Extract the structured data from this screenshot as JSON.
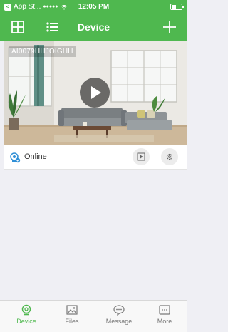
{
  "status_bar": {
    "carrier": "App St...",
    "signal": "●●●●●",
    "time": "12:05 PM",
    "back_glyph": "<"
  },
  "navbar": {
    "title": "Device"
  },
  "device": {
    "name": "AI0079HHJOIGHH",
    "status": "Online"
  },
  "tabs": [
    {
      "label": "Device",
      "icon": "webcam-icon",
      "active": true
    },
    {
      "label": "Files",
      "icon": "image-icon",
      "active": false
    },
    {
      "label": "Message",
      "icon": "chat-bubble-icon",
      "active": false
    },
    {
      "label": "More",
      "icon": "more-dots-icon",
      "active": false
    }
  ],
  "colors": {
    "brand": "#4fb84f",
    "background": "#efeff4"
  }
}
